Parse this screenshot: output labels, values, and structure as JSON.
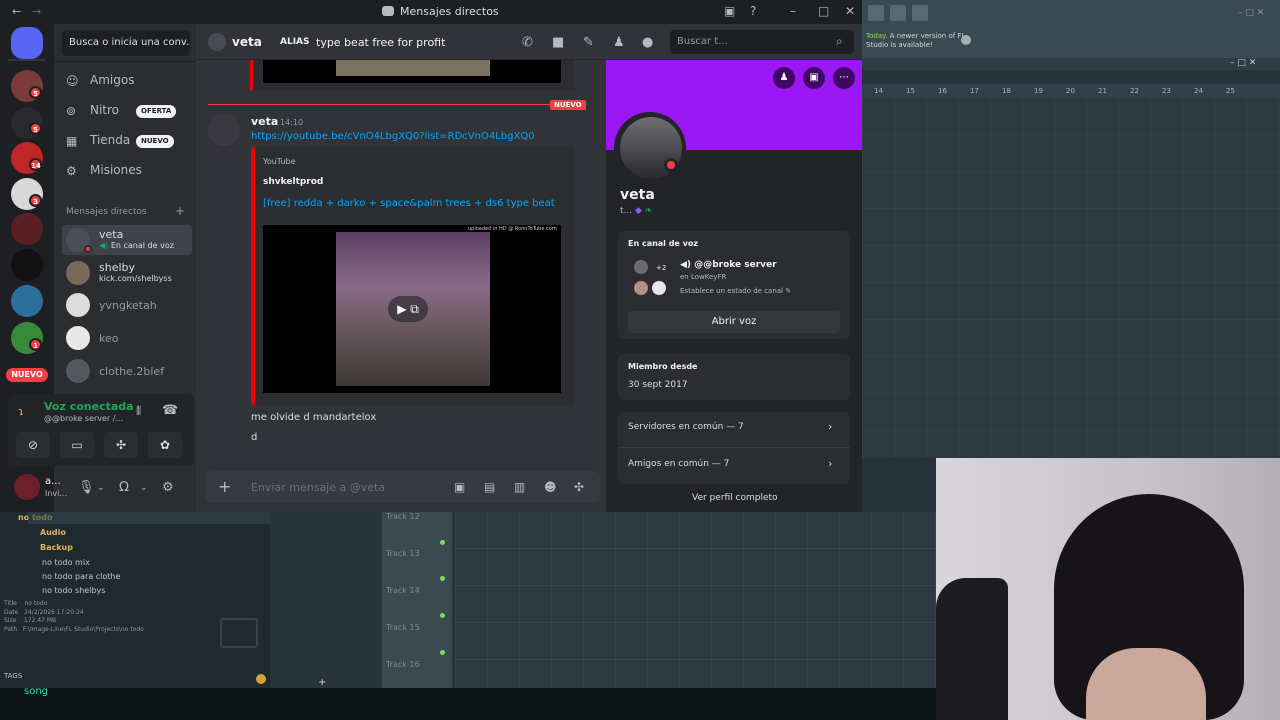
{
  "discord": {
    "window_title": "Mensajes directos",
    "search_placeholder": "Busca o inicia una conv...",
    "nav": [
      {
        "label": "Amigos",
        "icon": "friends-icon"
      },
      {
        "label": "Nitro",
        "icon": "nitro-icon",
        "pill": "OFERTA"
      },
      {
        "label": "Tienda",
        "icon": "shop-icon",
        "pill": "NUEVO"
      },
      {
        "label": "Misiones",
        "icon": "quests-icon"
      }
    ],
    "dm_header": "Mensajes directos",
    "dms": [
      {
        "name": "veta",
        "sub": "En canal de voz"
      },
      {
        "name": "shelby",
        "sub": "kick.com/shelbyss"
      },
      {
        "name": "yvngketah",
        "sub": ""
      },
      {
        "name": "keo",
        "sub": ""
      },
      {
        "name": "clothe.2blef",
        "sub": ""
      }
    ],
    "servers": [
      {
        "badge": "5"
      },
      {
        "badge": "5"
      },
      {
        "badge": "14"
      },
      {
        "badge": "3"
      },
      {
        "badge": ""
      },
      {
        "badge": ""
      },
      {
        "badge": ""
      },
      {
        "badge": "1"
      }
    ],
    "new_badge": "NUEVO",
    "voice": {
      "status": "Voz conectada",
      "channel": "@@broke server /..."
    },
    "user": {
      "name": "a...",
      "status": "Invi..."
    },
    "chat": {
      "recipient": "veta",
      "alias_label": "ALIAS",
      "alias_value": "type beat free for profit",
      "search_placeholder": "Buscar t...",
      "new_marker": "NUEVO",
      "message": {
        "author": "veta",
        "time": "14:10",
        "link": "https://youtube.be/cVnO4LbgXQ0?list=RDcVnO4LbgXQ0",
        "embed_provider": "YouTube",
        "embed_author": "shvkeltprod",
        "embed_title": "[free] redda + darko + space&palm trees + ds6 type beat",
        "embed_watermark": "uploaded in HD @ RonnToTube.com"
      },
      "followups": [
        "me olvide d mandartelox",
        "d"
      ],
      "composer_placeholder": "Enviar mensaje a @veta"
    },
    "profile": {
      "name": "veta",
      "tag": "t...",
      "voice_header": "En canal de voz",
      "voice_channel": "@@broke server",
      "voice_server": "en LowKeyFR",
      "voice_extra": "+2",
      "voice_status_hint": "Establece un estado de canal",
      "open_voice": "Abrir voz",
      "member_since_label": "Miembro desde",
      "member_since": "30 sept 2017",
      "mutual_servers": "Servidores en común — 7",
      "mutual_friends": "Amigos en común — 7",
      "view_full": "Ver perfil completo"
    }
  },
  "fl_studio": {
    "notice_prefix": "Today.",
    "notice": "A newer version of FL Studio is available!",
    "ruler": [
      "14",
      "15",
      "16",
      "17",
      "18",
      "19",
      "20",
      "21",
      "22",
      "23",
      "24",
      "25"
    ],
    "tracks": [
      "Track 12",
      "Track 13",
      "Track 14",
      "Track 15",
      "Track 16"
    ],
    "browser": {
      "root": "no todo",
      "folders": [
        "Audio",
        "Backup"
      ],
      "files": [
        "no todo mix",
        "no todo para clothe",
        "no todo shelbys"
      ],
      "info": [
        {
          "k": "Title",
          "v": "no todo"
        },
        {
          "k": "Date",
          "v": "24/2/2026 17:20:24"
        },
        {
          "k": "Size",
          "v": "172.47 MB"
        },
        {
          "k": "Path",
          "v": "F:\\Image-Line\\FL Studio\\Projects\\no todo"
        }
      ],
      "tags_label": "TAGS"
    },
    "song_label": "song"
  },
  "colors": {
    "discord_bg": "#313338",
    "banner": "#9b17f5",
    "accent_link": "#00a8fc",
    "danger": "#f23f43",
    "online": "#23a55a"
  }
}
